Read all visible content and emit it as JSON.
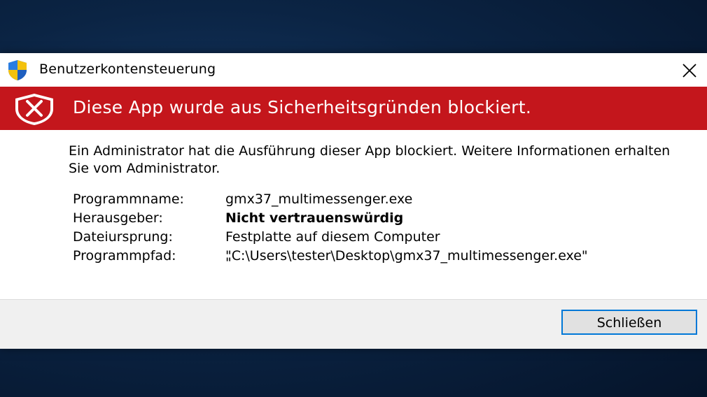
{
  "window": {
    "title": "Benutzerkontensteuerung",
    "close_icon": "close-icon"
  },
  "banner": {
    "text": "Diese App wurde aus Sicherheitsgründen blockiert.",
    "icon": "shield-error-icon",
    "color": "#c4161c"
  },
  "message": "Ein Administrator hat die Ausführung dieser App blockiert. Weitere Informationen erhalten Sie vom Administrator.",
  "details": [
    {
      "label": "Programmname:",
      "value": "gmx37_multimessenger.exe",
      "bold": false
    },
    {
      "label": "Herausgeber:",
      "value": "Nicht vertrauenswürdig",
      "bold": true
    },
    {
      "label": "Dateiursprung:",
      "value": "Festplatte auf diesem Computer",
      "bold": false
    },
    {
      "label": "Programmpfad:",
      "value": "\"C:\\Users\\tester\\Desktop\\gmx37_multimessenger.exe\"",
      "bold": false
    }
  ],
  "path_continuation": "\"",
  "footer": {
    "close_button_label": "Schließen"
  },
  "colors": {
    "accent": "#0078d7",
    "banner": "#c4161c",
    "footer": "#f0f0f0"
  }
}
